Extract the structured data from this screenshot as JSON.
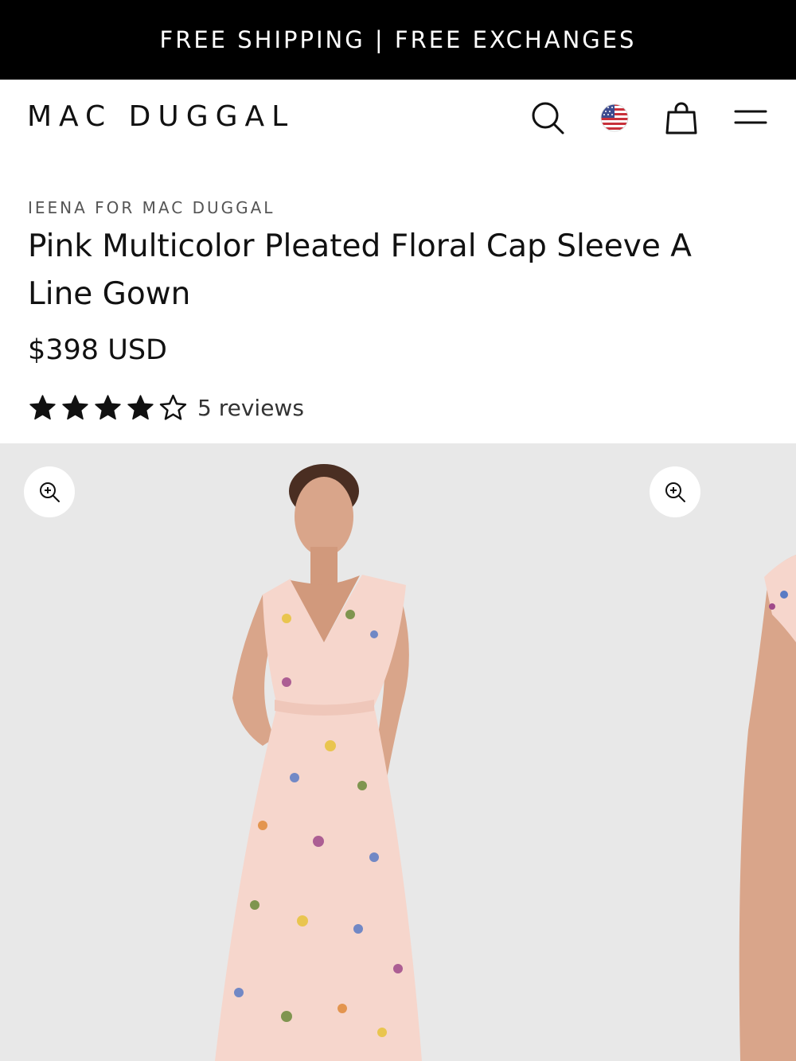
{
  "announcement": {
    "text": "FREE SHIPPING | FREE EXCHANGES"
  },
  "header": {
    "logo": "MAC DUGGAL",
    "icons": [
      "search-icon",
      "us-flag-icon",
      "shopping-bag-icon",
      "menu-icon"
    ]
  },
  "product": {
    "brand": "IEENA FOR MAC DUGGAL",
    "title": "Pink Multicolor Pleated Floral Cap Sleeve A Line Gown",
    "price": "$398 USD",
    "rating": {
      "value": 4,
      "max": 5,
      "reviews_label": "5 reviews"
    }
  },
  "colors": {
    "announcement_bg": "#000000",
    "gallery_bg": "#e8e8e8",
    "dress": "#f6d6cc",
    "skin": "#d9a58a"
  }
}
